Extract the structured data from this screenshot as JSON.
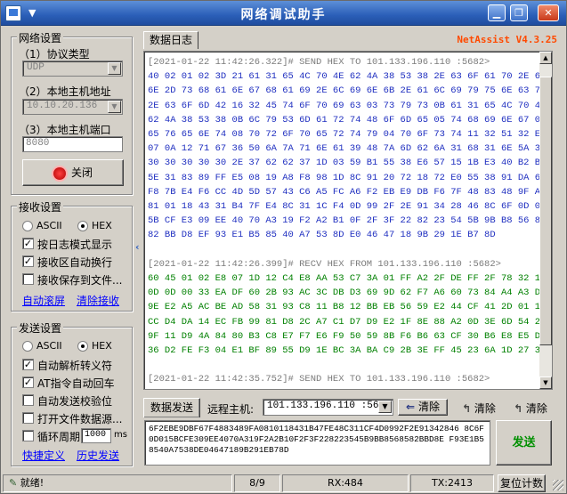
{
  "window": {
    "title": "网络调试助手",
    "sysmenu": "▼",
    "min": "▁",
    "restore": "❐",
    "close": "✕"
  },
  "network": {
    "group_title": "网络设置",
    "protocol_label": "（1）协议类型",
    "protocol_value": "UDP",
    "host_label": "（2）本地主机地址",
    "host_value": "10.10.20.136",
    "port_label": "（3）本地主机端口",
    "port_value": "8080",
    "close_button": "关闭"
  },
  "receive": {
    "group_title": "接收设置",
    "ascii": "ASCII",
    "hex": "HEX",
    "opt_log": "按日志模式显示",
    "opt_wrap": "接收区自动换行",
    "opt_file": "接收保存到文件...",
    "link_autoclear": "自动滚屏",
    "link_clear": "清除接收"
  },
  "send": {
    "group_title": "发送设置",
    "ascii": "ASCII",
    "hex": "HEX",
    "opt_escape": "自动解析转义符",
    "opt_at": "AT指令自动回车",
    "opt_checksum": "自动发送校验位",
    "opt_file": "打开文件数据源...",
    "opt_loop": "循环周期",
    "loop_value": "1000",
    "loop_unit": "ms",
    "link_quick": "快捷定义",
    "link_history": "历史发送"
  },
  "log": {
    "tab": "数据日志",
    "brand": "NetAssist V4.3.25",
    "blocks": [
      {
        "kind": "snd",
        "header": "[2021-01-22 11:42:26.322]# SEND HEX TO 101.133.196.110 :5682>",
        "lines": [
          "40 02 01 02 3D 21 61 31 65 4C 70 4E 62 4A 38 53 38 2E 63 6F 61 70 2E 63",
          "6E 2D 73 68 61 6E 67 68 61 69 2E 6C 69 6E 6B 2E 61 6C 69 79 75 6E 63 73",
          "2E 63 6F 6D 42 16 32 45 74 6F 70 69 63 03 73 79 73 0B 61 31 65 4C 70 4E",
          "62 4A 38 53 38 0B 6C 79 53 6D 61 72 74 48 6F 6D 65 05 74 68 69 6E 67 05",
          "65 76 65 6E 74 08 70 72 6F 70 65 72 74 79 04 70 6F 73 74 11 32 51 32 ED",
          "07 0A 12 71 67 36 50 6A 7A 71 6E 61 39 48 7A 6D 62 6A 31 68 31 6E 5A 30",
          "30 30 30 30 30 2E 37 62 62 37 1D 03 59 B1 55 38 E6 57 15 1B E3 40 B2 BB",
          "5E 31 83 89 FF E5 08 19 A8 F8 98 1D 8C 91 20 72 18 72 E0 55 38 91 DA 65",
          "F8 7B E4 F6 CC 4D 5D 57 43 C6 A5 FC A6 F2 EB E9 DB F6 7F 48 83 48 9F A0",
          "81 01 18 43 31 B4 7F E4 8C 31 1C F4 0D 99 2F 2E 91 34 28 46 8C 6F 0D 01",
          "5B CF E3 09 EE 40 70 A3 19 F2 A2 B1 0F 2F 3F 22 82 23 54 5B 9B B8 56 85",
          "82 BB D8 EF 93 E1 B5 85 40 A7 53 8D E0 46 47 18 9B 29 1E B7 8D"
        ]
      },
      {
        "kind": "rcv",
        "header": "[2021-01-22 11:42:26.399]# RECV HEX FROM 101.133.196.110 :5682>",
        "lines": [
          "60 45 01 02 E8 07 1D 12 C4 E8 AA 53 C7 3A 01 FF A2 2F DE FF 2F 78 32 10",
          "0D 0D 00 33 EA DF 60 2B 93 AC 3C DB D3 69 9D 62 F7 A6 60 73 84 A4 A3 DC",
          "9E E2 A5 AC BE AD 58 31 93 C8 11 B8 12 BB EB 56 59 E2 44 CF 41 2D 01 11",
          "CC D4 DA 14 EC FB 99 81 D8 2C A7 C1 D7 D9 E2 1F 8E 88 A2 0D 3E 6D 54 20",
          "9F 11 D9 4A 84 80 B3 C8 E7 F7 E6 F9 50 59 8B F6 B6 63 CF 30 B6 E8 E5 D1",
          "36 D2 FE F3 04 E1 BF 89 55 D9 1E BC 3A BA C9 2B 3E FF 45 23 6A 1D 27 30"
        ]
      },
      {
        "kind": "snd",
        "header": "[2021-01-22 11:42:35.752]# SEND HEX TO 101.133.196.110 :5682>",
        "lines": []
      }
    ]
  },
  "sendbar": {
    "tab": "数据发送",
    "remote_label": "远程主机:",
    "remote_value": "101.133.196.110  :5682",
    "clear1": "清除",
    "clear2": "清除",
    "clear3": "清除",
    "text": "6F2EBE9DBF67F4883489FA0810118431B47FE48C311CF4D0992F2E91342846 8C6F0D015BCFE309EE4070A319F2A2B10F2F3F228223545B9BB8568582BBD8E F93E1B58540A7538DE04647189B291EB78D",
    "send_button": "发送"
  },
  "status": {
    "ready": "就绪!",
    "count": "8/9",
    "rx": "RX:484",
    "tx": "TX:2413",
    "reset": "复位计数"
  }
}
